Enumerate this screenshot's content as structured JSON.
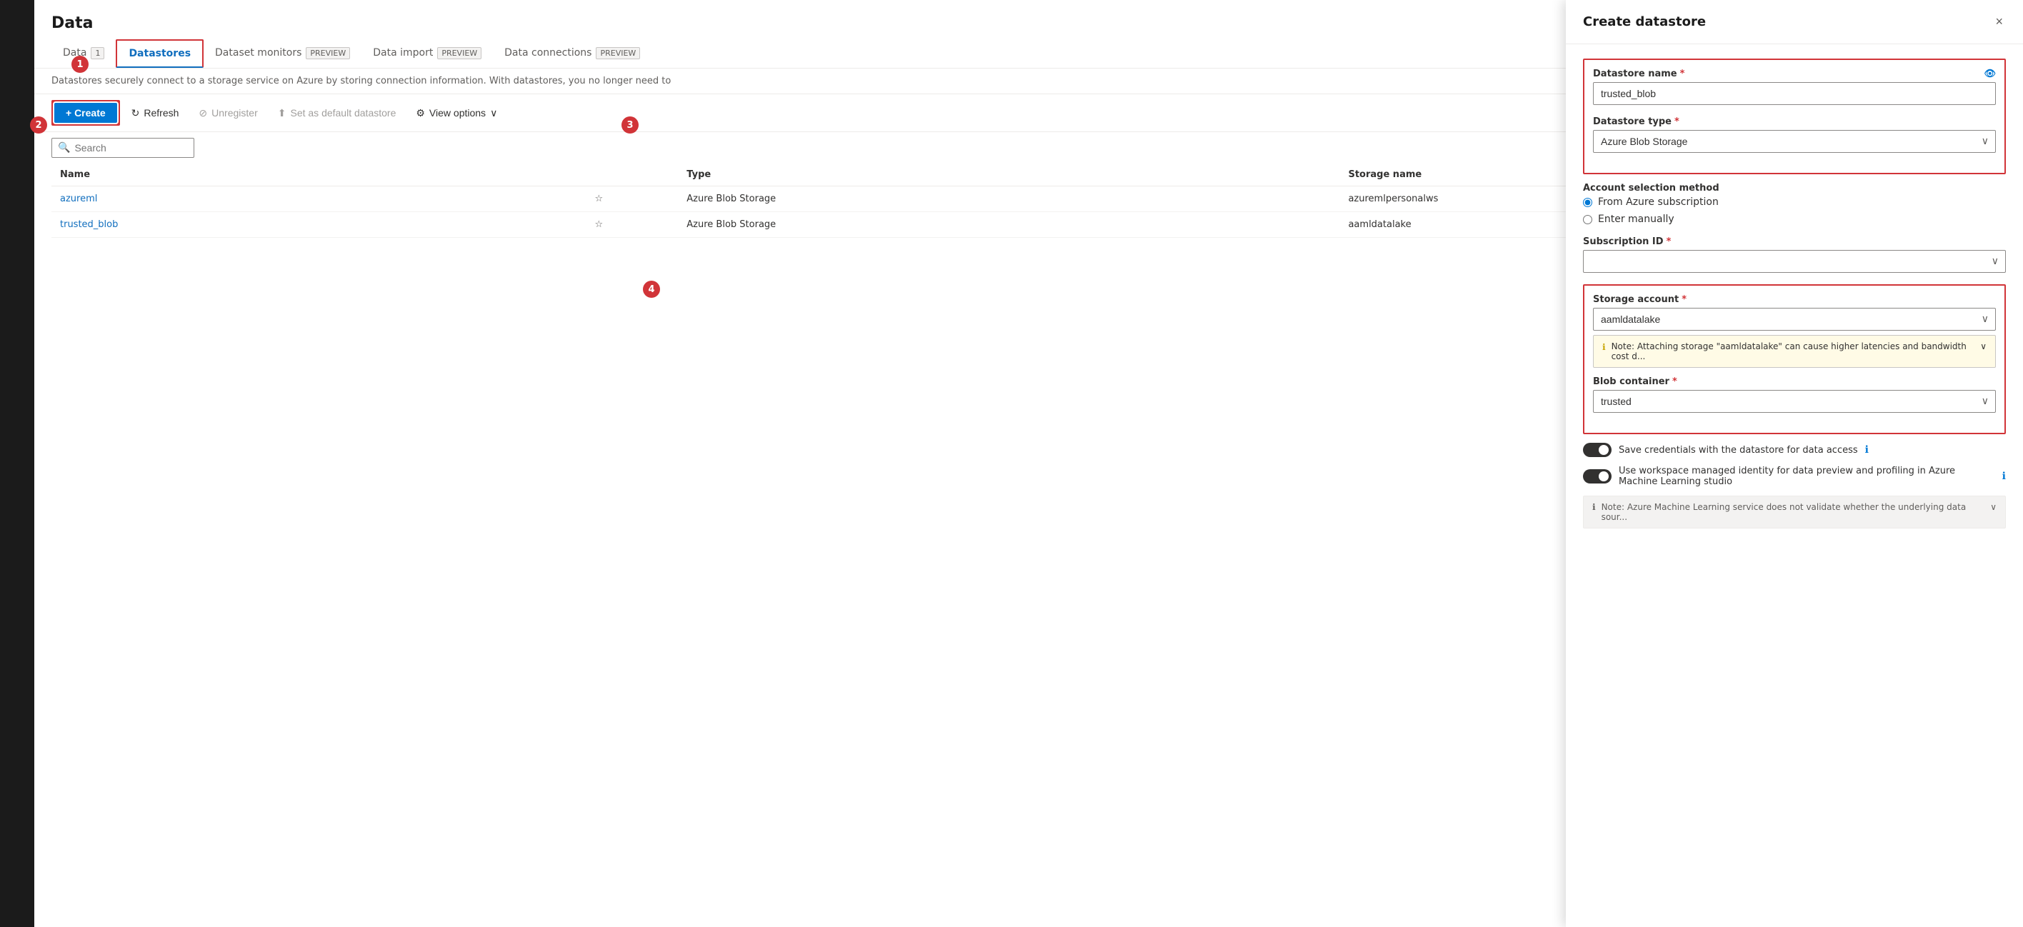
{
  "page": {
    "title": "Data"
  },
  "tabs": [
    {
      "id": "data",
      "label": "Data",
      "badge": "1",
      "active": false
    },
    {
      "id": "datastores",
      "label": "Datastores",
      "active": true
    },
    {
      "id": "dataset-monitors",
      "label": "Dataset monitors",
      "badge": "PREVIEW",
      "active": false
    },
    {
      "id": "data-import",
      "label": "Data import",
      "badge": "PREVIEW",
      "active": false
    },
    {
      "id": "data-connections",
      "label": "Data connections",
      "badge": "PREVIEW",
      "active": false
    }
  ],
  "description": "Datastores securely connect to a storage service on Azure by storing connection information. With datastores, you no longer need to",
  "toolbar": {
    "create_label": "+ Create",
    "refresh_label": "Refresh",
    "unregister_label": "Unregister",
    "set_default_label": "Set as default datastore",
    "view_options_label": "View options"
  },
  "search": {
    "placeholder": "Search"
  },
  "table": {
    "columns": [
      "Name",
      "",
      "Type",
      "Storage name"
    ],
    "rows": [
      {
        "name": "azureml",
        "type": "Azure Blob Storage",
        "storage": "azuremlpersonalws"
      },
      {
        "name": "trusted_blob",
        "type": "Azure Blob Storage",
        "storage": "aamldatalake"
      }
    ]
  },
  "panel": {
    "title": "Create datastore",
    "close_label": "×",
    "datastore_name_label": "Datastore name",
    "datastore_name_value": "trusted_blob",
    "datastore_type_label": "Datastore type",
    "datastore_type_value": "Azure Blob Storage",
    "account_selection_label": "Account selection method",
    "radio_azure": "From Azure subscription",
    "radio_manual": "Enter manually",
    "subscription_id_label": "Subscription ID",
    "storage_account_label": "Storage account",
    "storage_account_value": "aamldatalake",
    "note_text": "Note: Attaching storage \"aamldatalake\" can cause higher latencies and bandwidth cost d...",
    "blob_container_label": "Blob container",
    "blob_container_value": "trusted",
    "save_credentials_label": "Save credentials with the datastore for data access",
    "workspace_identity_label": "Use workspace managed identity for data preview and profiling in Azure Machine Learning studio",
    "bottom_note": "Note: Azure Machine Learning service does not validate whether the underlying data sour..."
  },
  "steps": {
    "s1": "1",
    "s2": "2",
    "s3": "3",
    "s4": "4"
  }
}
